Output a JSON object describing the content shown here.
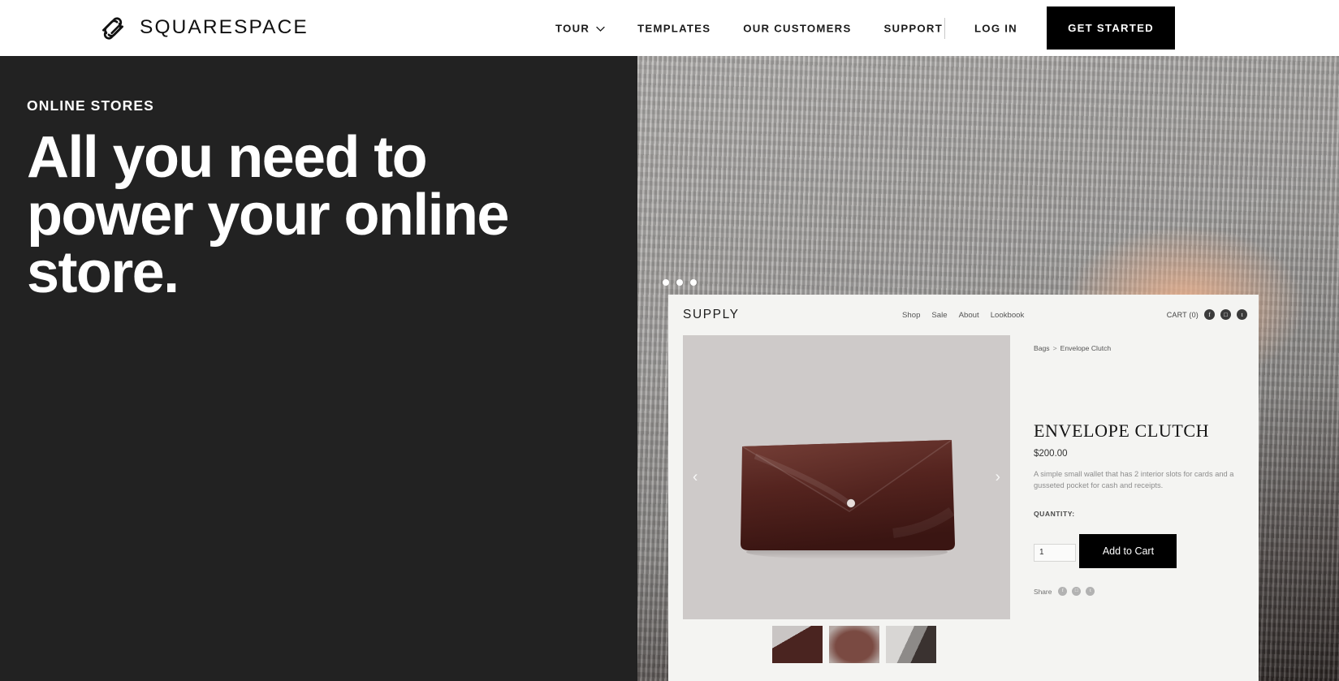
{
  "topnav": {
    "brand": "SQUARESPACE",
    "logo_icon": "squarespace-logo-icon",
    "links": [
      {
        "label": "TOUR",
        "icon": "chevron-down-icon"
      },
      {
        "label": "TEMPLATES"
      },
      {
        "label": "OUR CUSTOMERS"
      },
      {
        "label": "SUPPORT"
      }
    ],
    "login_label": "LOG IN",
    "cta_label": "GET STARTED"
  },
  "hero": {
    "eyebrow": "ONLINE STORES",
    "headline": "All you need to power your online store.",
    "bg_dark": "#222222"
  },
  "mockup": {
    "window_dots": 3,
    "site": {
      "logo": "SUPPLY",
      "nav": [
        "Shop",
        "Sale",
        "About",
        "Lookbook"
      ],
      "cart_label": "CART (0)",
      "social": [
        {
          "name": "facebook-icon",
          "glyph": "f"
        },
        {
          "name": "instagram-icon",
          "glyph": "□"
        },
        {
          "name": "twitter-icon",
          "glyph": "t"
        }
      ]
    },
    "product": {
      "breadcrumb_parent": "Bags",
      "breadcrumb_sep": ">",
      "breadcrumb_current": "Envelope Clutch",
      "title": "ENVELOPE CLUTCH",
      "price": "$200.00",
      "description": "A simple small wallet that has 2 interior slots for cards and a gusseted pocket for cash and receipts.",
      "quantity_label": "QUANTITY:",
      "quantity_value": "1",
      "add_to_cart_label": "Add to Cart",
      "share_label": "Share",
      "share_icons": [
        {
          "name": "facebook-icon",
          "glyph": "f"
        },
        {
          "name": "instagram-icon",
          "glyph": "□"
        },
        {
          "name": "twitter-icon",
          "glyph": "t"
        }
      ],
      "prev_arrow": "‹",
      "next_arrow": "›",
      "thumbnails": [
        "clutch-angle-thumb",
        "clutch-detail-thumb",
        "clutch-model-thumb"
      ]
    }
  }
}
